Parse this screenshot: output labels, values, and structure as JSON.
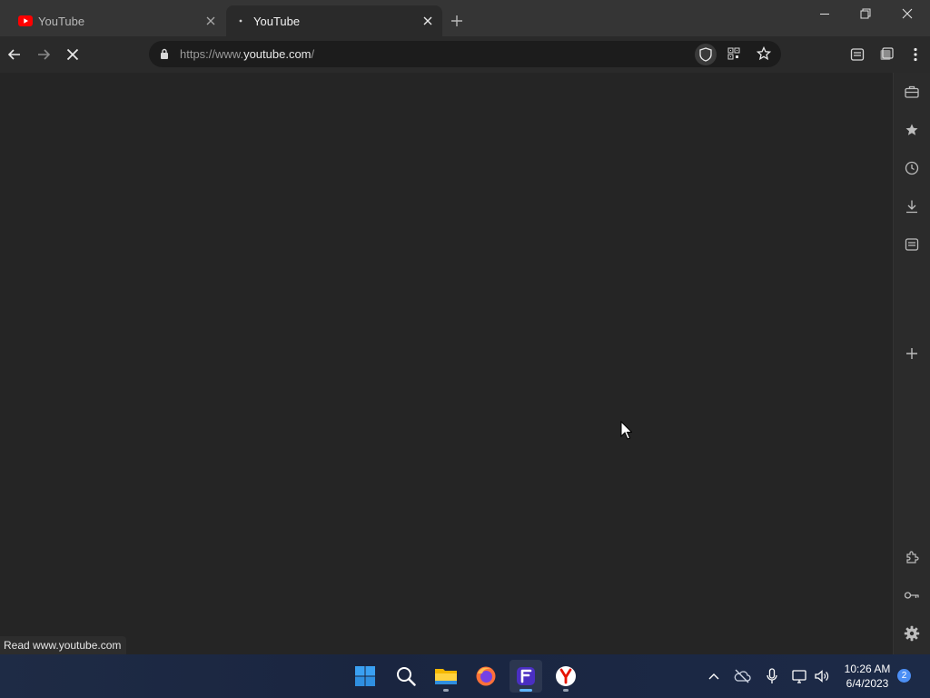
{
  "browser": {
    "tabs": [
      {
        "title": "YouTube",
        "active": false,
        "favicon": "youtube-favicon"
      },
      {
        "title": "YouTube",
        "active": true,
        "favicon": "loading-indicator"
      }
    ],
    "url_prefix": "https://www.",
    "url_host": "youtube.com",
    "url_suffix": "/",
    "status_text": "Read www.youtube.com"
  },
  "taskbar": {
    "apps": [
      "windows-start",
      "search",
      "file-explorer",
      "firefox",
      "app-f",
      "yandex-browser"
    ],
    "active_app": "app-f",
    "time": "10:26 AM",
    "date": "6/4/2023",
    "notification_count": "2"
  },
  "colors": {
    "accent": "#4c8ff5",
    "youtube_red": "#ff0000",
    "page_bg": "#252525"
  }
}
